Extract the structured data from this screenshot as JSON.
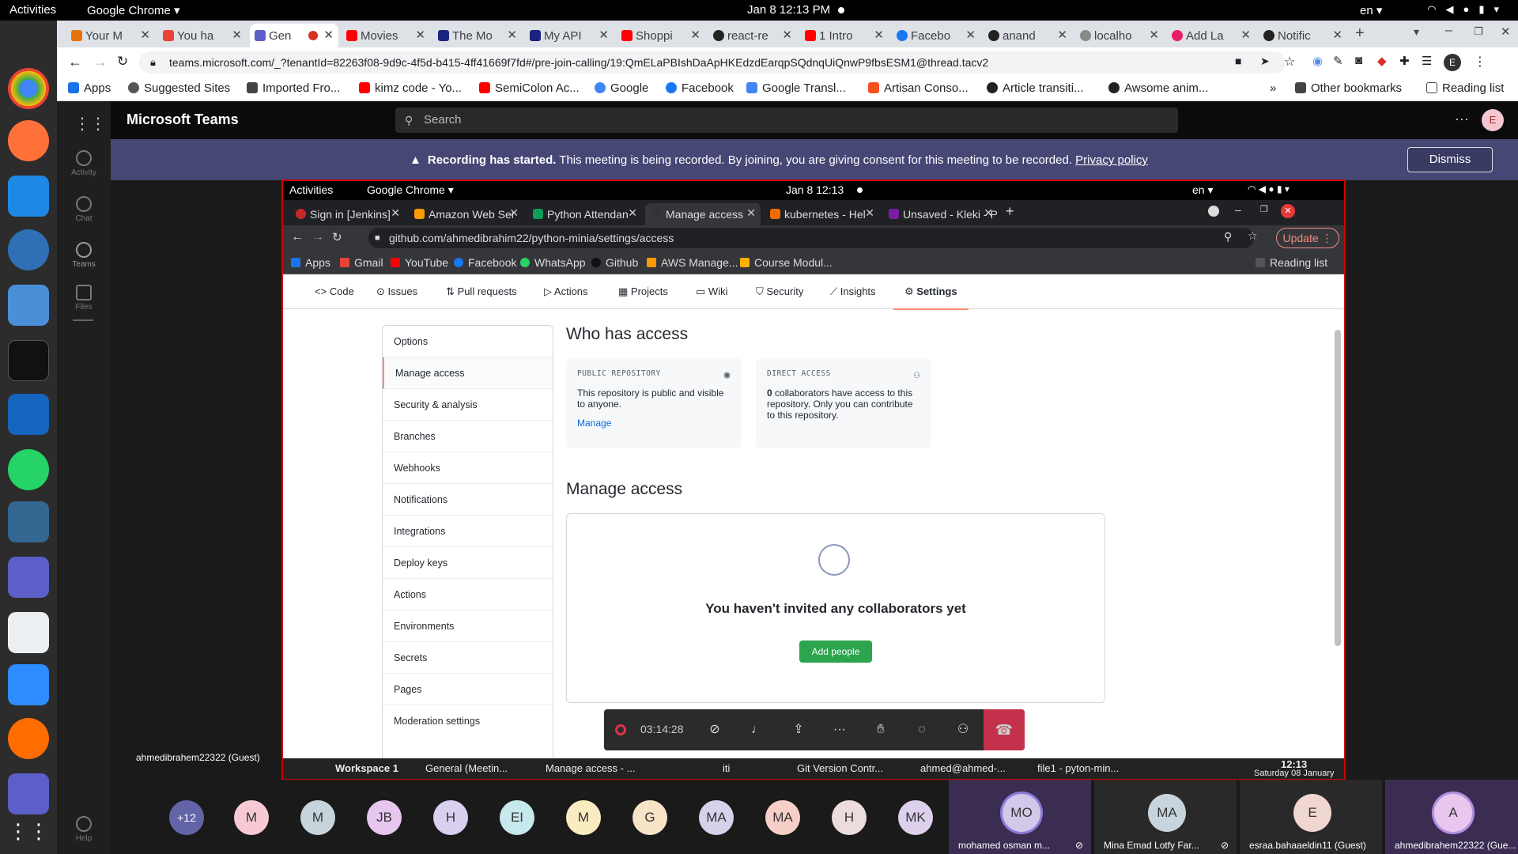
{
  "os": {
    "activities": "Activities",
    "app": "Google Chrome",
    "clock": "Jan 8  12:13 PM",
    "lang": "en"
  },
  "chrome": {
    "tabs": [
      "Your M",
      "You ha",
      "Gen",
      "Movies",
      "The Mo",
      "My API",
      "Shoppi",
      "react-re",
      "1 Intro",
      "Facebo",
      "anand",
      "localho",
      "Add La",
      "Notific"
    ],
    "url": "teams.microsoft.com/_?tenantId=82263f08-9d9c-4f5d-b415-4ff41669f7fd#/pre-join-calling/19:QmELaPBIshDaApHKEdzdEarqpSQdnqUiQnwP9fbsESM1@thread.tacv2",
    "bookmarks": [
      "Apps",
      "Suggested Sites",
      "Imported Fro...",
      "kimz code - Yo...",
      "SemiColon Ac...",
      "Google",
      "Facebook",
      "Google Transl...",
      "Artisan Conso...",
      "Article transiti...",
      "Awsome anim..."
    ],
    "other_bookmarks": "Other bookmarks",
    "reading_list": "Reading list"
  },
  "teams": {
    "title": "Microsoft Teams",
    "search": "Search",
    "rail": [
      "Activity",
      "Chat",
      "Teams",
      "Files"
    ],
    "help": "Help",
    "avatar": "E",
    "banner": {
      "bold": "Recording has started.",
      "text": " This meeting is being recorded. By joining, you are giving consent for this meeting to be recorded. ",
      "link": "Privacy policy",
      "dismiss": "Dismiss"
    },
    "presenter": "ahmedibrahem22322 (Guest)"
  },
  "shared": {
    "os": {
      "activities": "Activities",
      "app": "Google Chrome",
      "clock": "Jan 8  12:13",
      "lang": "en"
    },
    "tabs": [
      "Sign in [Jenkins]",
      "Amazon Web Ser",
      "Python Attendan",
      "Manage access",
      "kubernetes - Hel",
      "Unsaved - Kleki - P"
    ],
    "url": "github.com/ahmedibrahim22/python-minia/settings/access",
    "update": "Update",
    "bookmarks": [
      "Apps",
      "Gmail",
      "YouTube",
      "Facebook",
      "WhatsApp",
      "Github",
      "AWS Manage...",
      "Course Modul..."
    ],
    "reading_list": "Reading list",
    "nav": [
      "Code",
      "Issues",
      "Pull requests",
      "Actions",
      "Projects",
      "Wiki",
      "Security",
      "Insights",
      "Settings"
    ],
    "side": [
      "Options",
      "Manage access",
      "Security & analysis",
      "Branches",
      "Webhooks",
      "Notifications",
      "Integrations",
      "Deploy keys",
      "Actions",
      "Environments",
      "Secrets",
      "Pages",
      "Moderation settings"
    ],
    "who": "Who has access",
    "public_label": "PUBLIC REPOSITORY",
    "public_text": "This repository is public and visible to anyone.",
    "public_link": "Manage",
    "direct_label": "DIRECT ACCESS",
    "direct_count": "0",
    "direct_text": " collaborators have access to this repository. Only you can contribute to this repository.",
    "manage": "Manage access",
    "empty": "You haven't invited any collaborators yet",
    "add": "Add people",
    "timer": "03:14:28",
    "taskbar": [
      "Workspace 1",
      "General (Meetin...",
      "Manage access - ...",
      "iti",
      "Git Version Contr...",
      "ahmed@ahmed-...",
      "file1 - pyton-min..."
    ],
    "tb_time": "12:13",
    "tb_date": "Saturday 08 January"
  },
  "participants": [
    "+12",
    "M",
    "M",
    "JB",
    "H",
    "EI",
    "M",
    "G",
    "MA",
    "MA",
    "H",
    "MK"
  ],
  "tiles": [
    {
      "initials": "MO",
      "name": "mohamed osman m..."
    },
    {
      "initials": "MA",
      "name": "Mina Emad Lotfy Far..."
    },
    {
      "initials": "E",
      "name": "esraa.bahaaeldin11 (Guest)"
    },
    {
      "initials": "A",
      "name": "ahmedibrahem22322 (Gue..."
    }
  ]
}
